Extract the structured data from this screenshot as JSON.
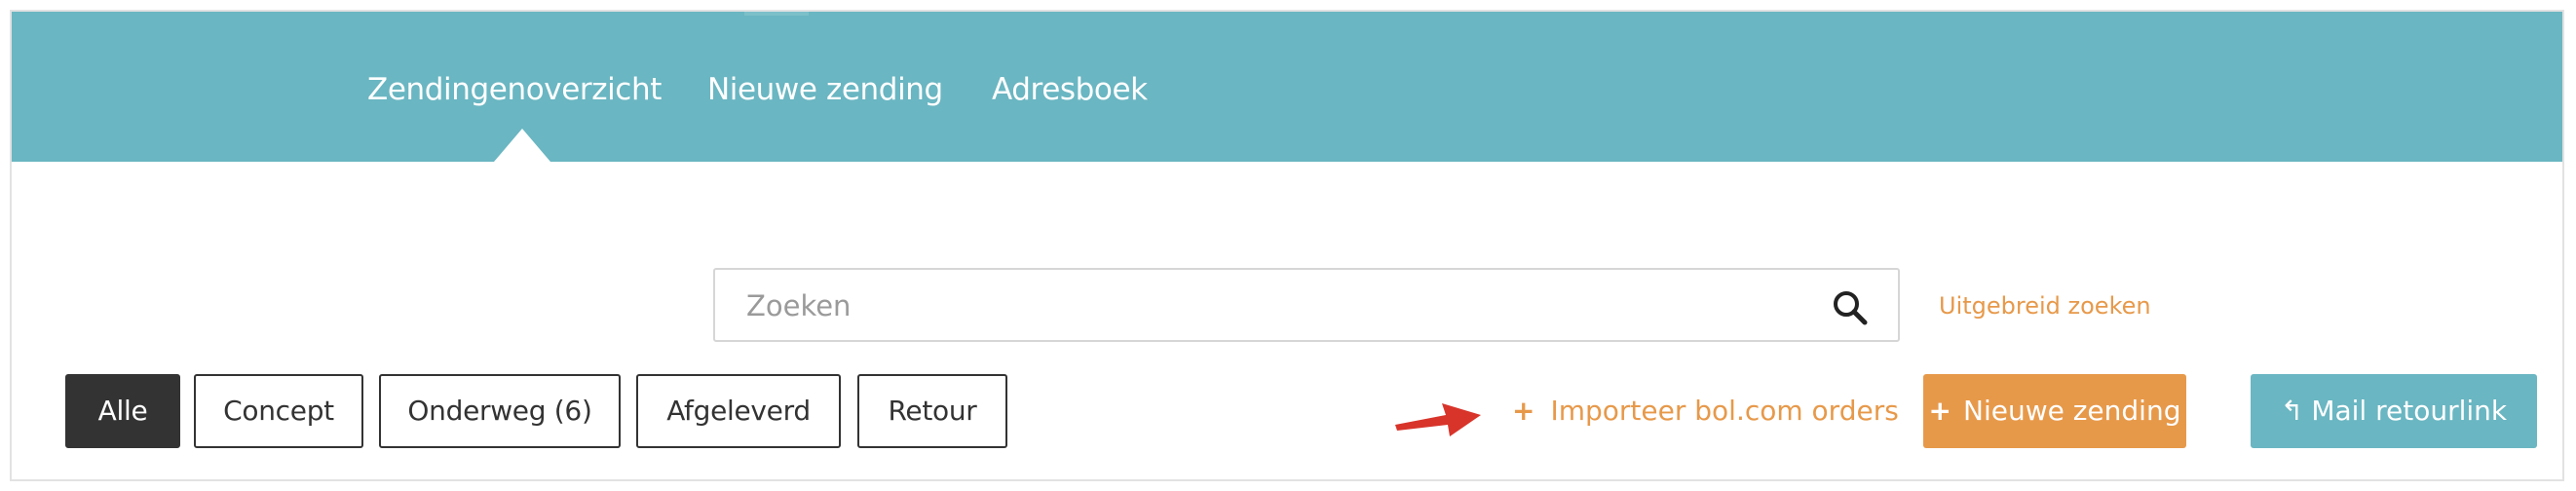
{
  "nav": {
    "items": [
      {
        "label": "Zendingenoverzicht",
        "active": true
      },
      {
        "label": "Nieuwe zending",
        "active": false
      },
      {
        "label": "Adresboek",
        "active": false
      }
    ]
  },
  "search": {
    "placeholder": "Zoeken",
    "value": "",
    "icon": "search-icon",
    "advanced_label": "Uitgebreid zoeken"
  },
  "filters": [
    {
      "label": "Alle",
      "active": true
    },
    {
      "label": "Concept",
      "active": false
    },
    {
      "label": "Onderweg (6)",
      "active": false
    },
    {
      "label": "Afgeleverd",
      "active": false
    },
    {
      "label": "Retour",
      "active": false
    }
  ],
  "actions": {
    "import_label": "Importeer bol.com orders",
    "new_shipment_label": "Nieuwe zending",
    "mail_return_label": "Mail retourlink"
  },
  "colors": {
    "header": "#6ab6c2",
    "accent_orange": "#e7994a",
    "dark": "#333333",
    "annotation_arrow": "#d8342a"
  }
}
